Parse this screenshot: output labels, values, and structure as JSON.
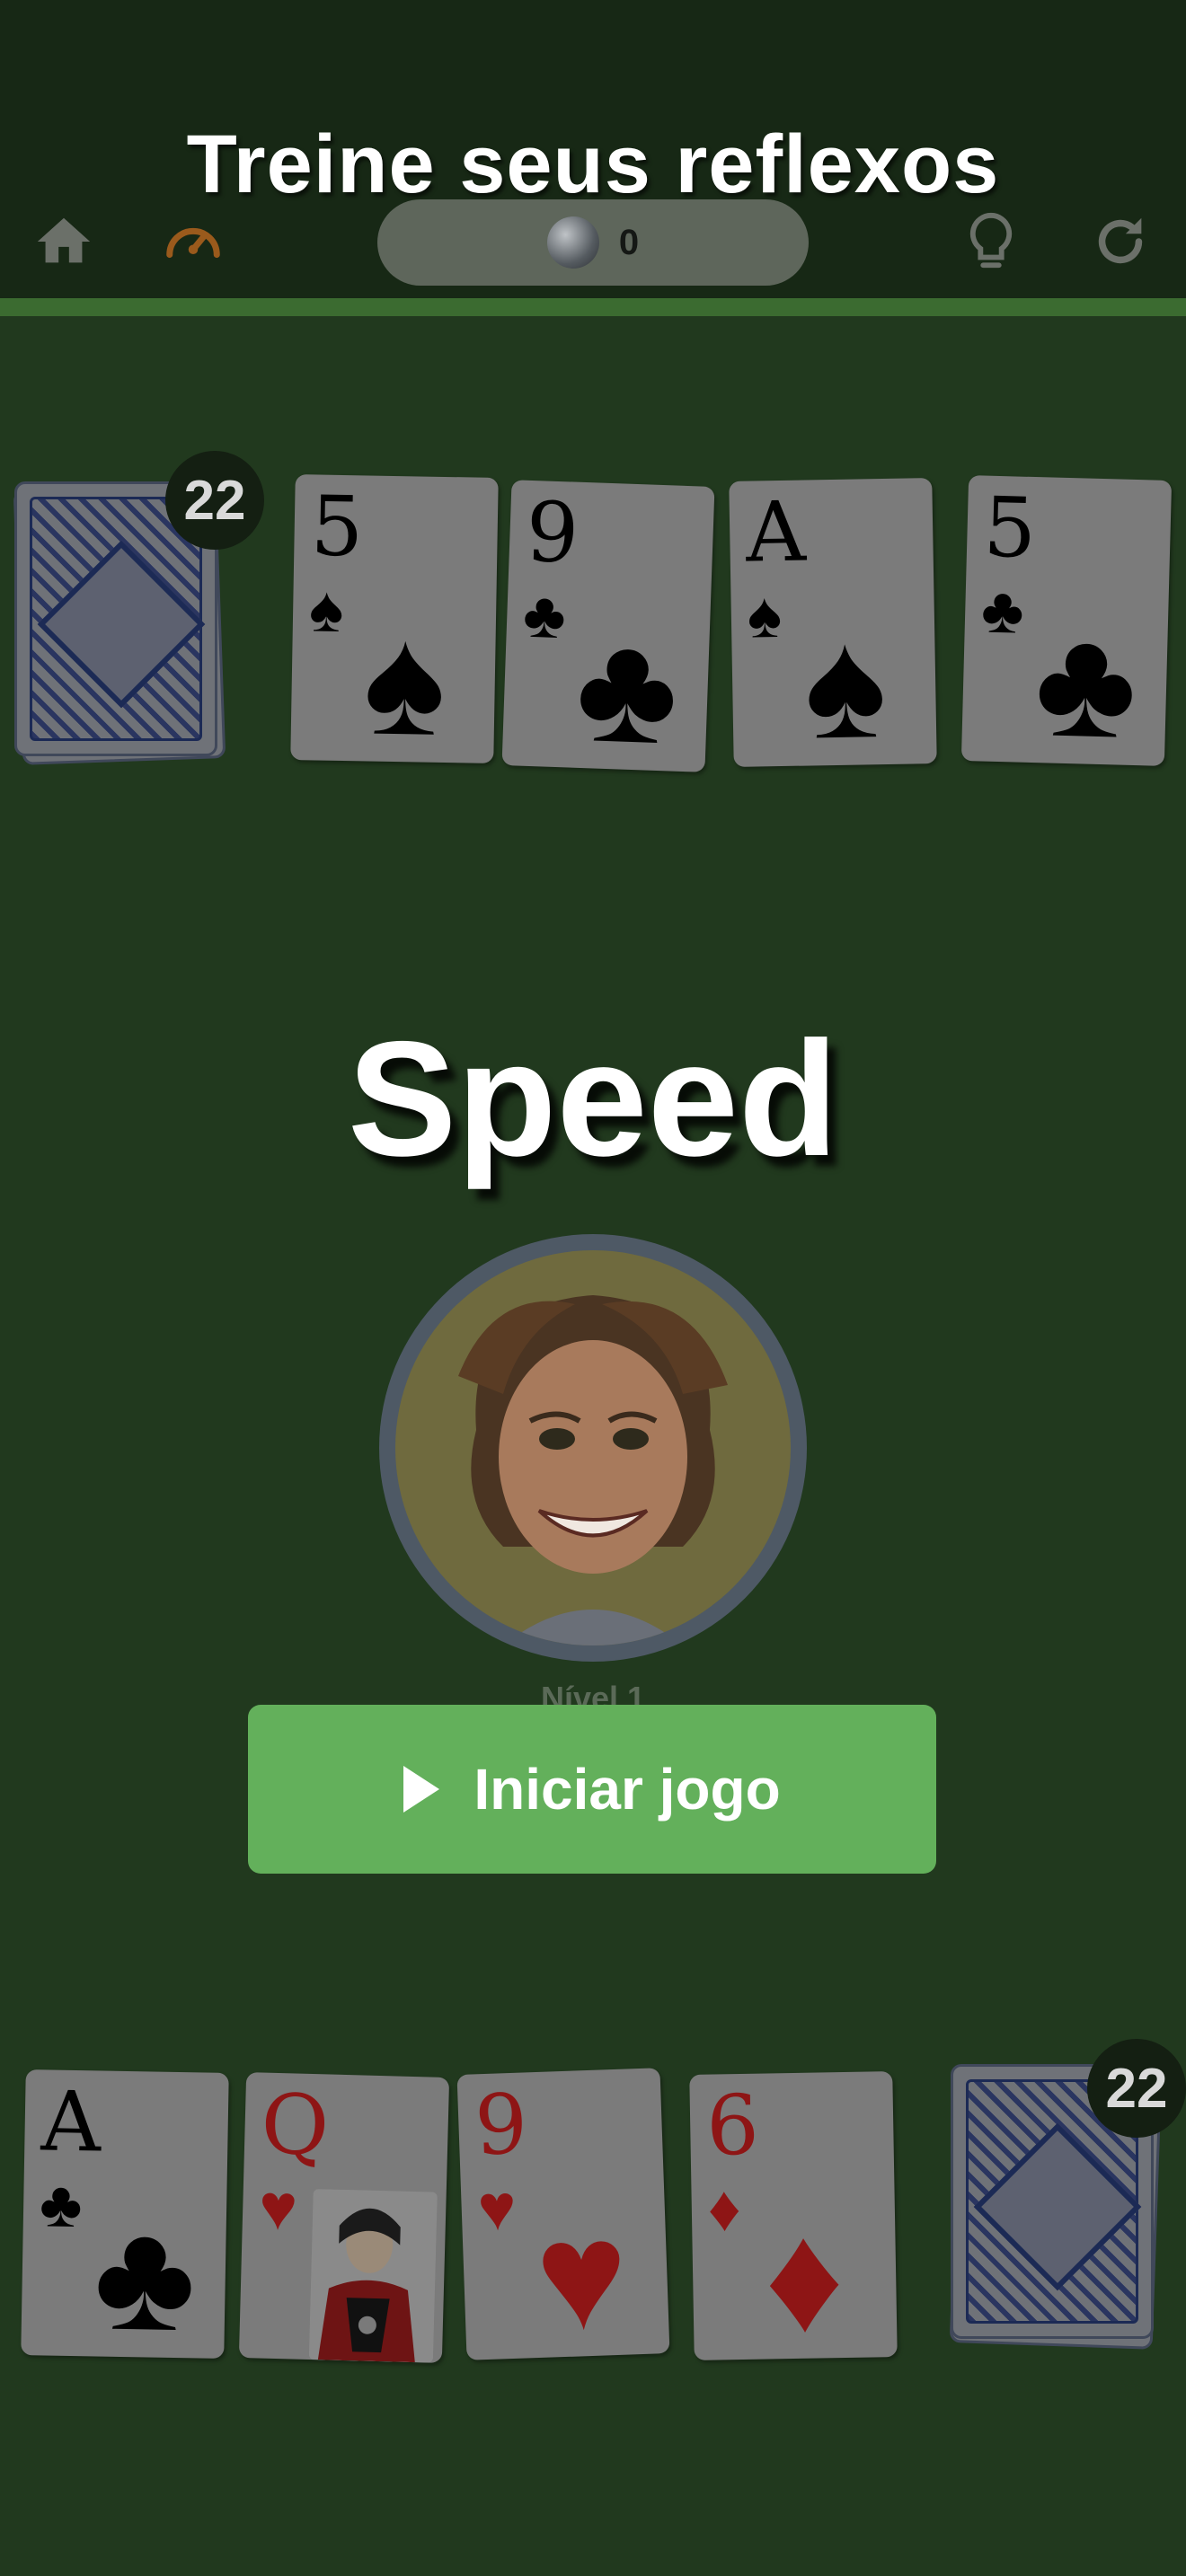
{
  "header": {
    "title": "Treine seus reflexos",
    "coins": "0",
    "icons": [
      "home-icon",
      "speedometer-icon",
      "coin-icon",
      "lightbulb-icon",
      "refresh-icon"
    ],
    "colors": {
      "bar": "#172815",
      "accent": "#3b6b30",
      "speed_icon": "#9a5a1c"
    }
  },
  "opponent": {
    "deck_count": "22",
    "cards": [
      {
        "rank": "5",
        "suit": "♠",
        "color": "black"
      },
      {
        "rank": "9",
        "suit": "♣",
        "color": "black"
      },
      {
        "rank": "A",
        "suit": "♠",
        "color": "black"
      },
      {
        "rank": "5",
        "suit": "♣",
        "color": "black"
      }
    ]
  },
  "overlay": {
    "game_title": "Speed",
    "level": "Nível 1",
    "start_label": "Iniciar jogo"
  },
  "player": {
    "deck_count": "22",
    "cards": [
      {
        "rank": "A",
        "suit": "♣",
        "color": "black"
      },
      {
        "rank": "Q",
        "suit": "♥",
        "color": "red"
      },
      {
        "rank": "9",
        "suit": "♥",
        "color": "red"
      },
      {
        "rank": "6",
        "suit": "♦",
        "color": "red"
      }
    ]
  },
  "table_color": "#21391e"
}
